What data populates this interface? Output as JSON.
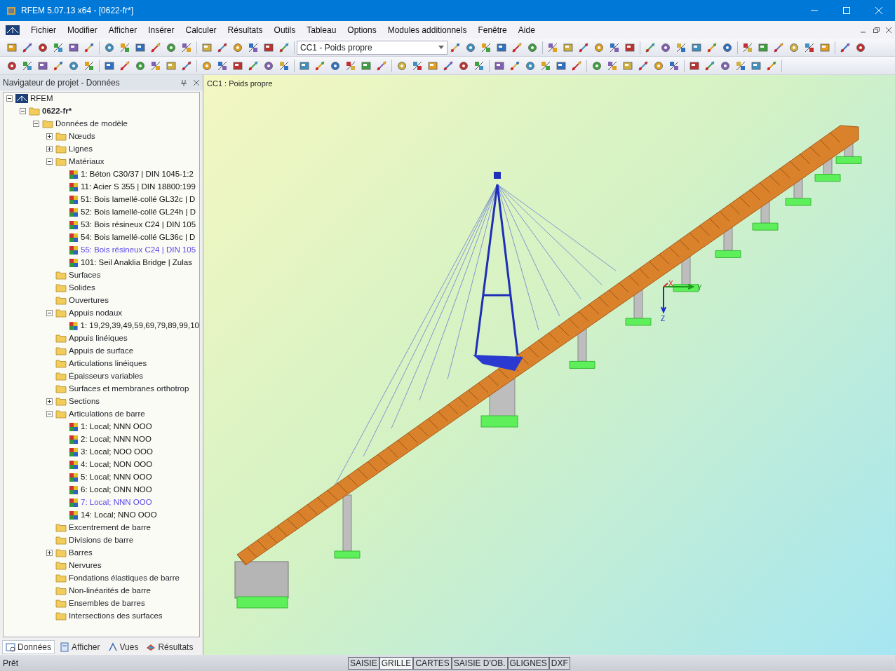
{
  "window": {
    "title": "RFEM 5.07.13 x64 - [0622-fr*]"
  },
  "menu": [
    "Fichier",
    "Modifier",
    "Afficher",
    "Insérer",
    "Calculer",
    "Résultats",
    "Outils",
    "Tableau",
    "Options",
    "Modules additionnels",
    "Fenêtre",
    "Aide"
  ],
  "load_case_combo": {
    "value": "CC1 - Poids propre"
  },
  "navigator": {
    "title": "Navigateur de projet - Données",
    "tree": [
      {
        "label": "RFEM",
        "expanded": true,
        "children": [
          {
            "label": "0622-fr*",
            "bold": true,
            "expanded": true,
            "children": [
              {
                "label": "Données de modèle",
                "expanded": true,
                "children": [
                  {
                    "label": "Nœuds",
                    "expanded": false
                  },
                  {
                    "label": "Lignes",
                    "expanded": false
                  },
                  {
                    "label": "Matériaux",
                    "expanded": true,
                    "children": [
                      {
                        "label": "1: Béton C30/37 | DIN 1045-1:2",
                        "highlighted": false
                      },
                      {
                        "label": "11: Acier S 355 | DIN 18800:199",
                        "highlighted": false
                      },
                      {
                        "label": "51: Bois lamellé-collé GL32c | D",
                        "highlighted": false
                      },
                      {
                        "label": "52: Bois lamellé-collé GL24h | D",
                        "highlighted": false
                      },
                      {
                        "label": "53: Bois résineux C24 | DIN 105",
                        "highlighted": false
                      },
                      {
                        "label": "54: Bois lamellé-collé GL36c | D",
                        "highlighted": false
                      },
                      {
                        "label": "55: Bois résineux C24 | DIN 105",
                        "highlighted": true
                      },
                      {
                        "label": "101: Seil Anaklia Bridge | Zulas",
                        "highlighted": false
                      }
                    ]
                  },
                  {
                    "label": "Surfaces"
                  },
                  {
                    "label": "Solides"
                  },
                  {
                    "label": "Ouvertures"
                  },
                  {
                    "label": "Appuis nodaux",
                    "expanded": true,
                    "children": [
                      {
                        "label": "1: 19,29,39,49,59,69,79,89,99,10",
                        "highlighted": false
                      }
                    ]
                  },
                  {
                    "label": "Appuis linéiques"
                  },
                  {
                    "label": "Appuis de surface"
                  },
                  {
                    "label": "Articulations linéiques"
                  },
                  {
                    "label": "Épaisseurs variables"
                  },
                  {
                    "label": "Surfaces et membranes orthotrop"
                  },
                  {
                    "label": "Sections",
                    "expanded": false
                  },
                  {
                    "label": "Articulations de barre",
                    "expanded": true,
                    "children": [
                      {
                        "label": "1: Local; NNN OOO",
                        "highlighted": false
                      },
                      {
                        "label": "2: Local; NNN NOO",
                        "highlighted": false
                      },
                      {
                        "label": "3: Local; NOO OOO",
                        "highlighted": false
                      },
                      {
                        "label": "4: Local; NON OOO",
                        "highlighted": false
                      },
                      {
                        "label": "5: Local; NNN OOO",
                        "highlighted": false
                      },
                      {
                        "label": "6: Local; ONN NOO",
                        "highlighted": false
                      },
                      {
                        "label": "7: Local; NNN OOO",
                        "highlighted": true
                      },
                      {
                        "label": "14: Local; NNO OOO",
                        "highlighted": false
                      }
                    ]
                  },
                  {
                    "label": "Excentrement de barre"
                  },
                  {
                    "label": "Divisions de barre"
                  },
                  {
                    "label": "Barres",
                    "expanded": false
                  },
                  {
                    "label": "Nervures"
                  },
                  {
                    "label": "Fondations élastiques de barre"
                  },
                  {
                    "label": "Non-linéarités de barre"
                  },
                  {
                    "label": "Ensembles de barres"
                  },
                  {
                    "label": "Intersections des surfaces"
                  }
                ]
              }
            ]
          }
        ]
      }
    ],
    "tabs": [
      {
        "label": "Données",
        "selected": true
      },
      {
        "label": "Afficher",
        "selected": false
      },
      {
        "label": "Vues",
        "selected": false
      },
      {
        "label": "Résultats",
        "selected": false
      }
    ]
  },
  "viewport": {
    "caption": "CC1 : Poids propre",
    "axes": [
      "X",
      "Y",
      "Z"
    ]
  },
  "status_bar": {
    "text": "Prêt",
    "buttons": [
      {
        "label": "SAISIE",
        "selected": false
      },
      {
        "label": "GRILLE",
        "selected": true
      },
      {
        "label": "CARTES",
        "selected": false
      },
      {
        "label": "SAISIE D'OB.",
        "selected": false
      },
      {
        "label": "GLIGNES",
        "selected": false
      },
      {
        "label": "DXF",
        "selected": false
      }
    ]
  }
}
